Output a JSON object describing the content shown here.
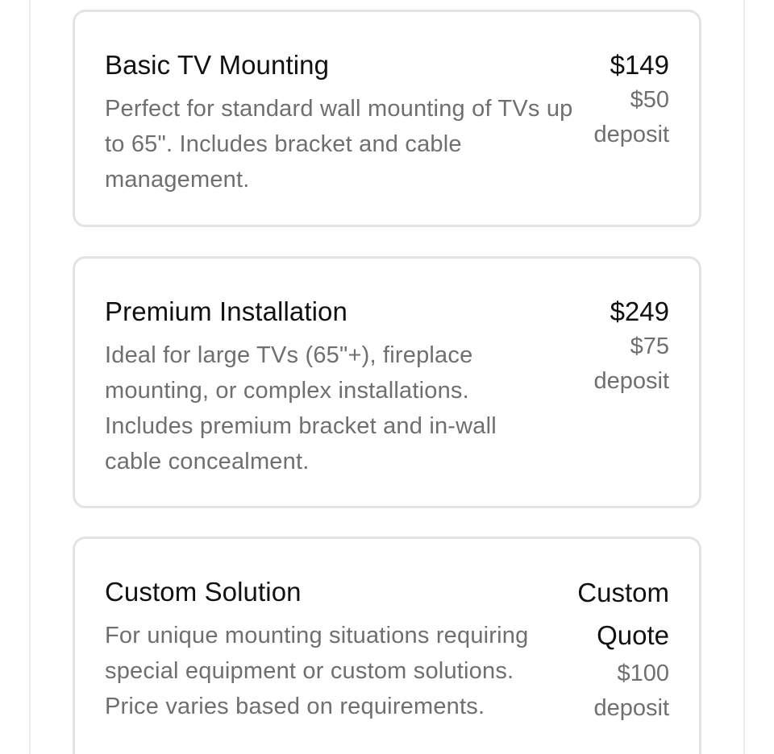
{
  "services": [
    {
      "title": "Basic TV Mounting",
      "description": "Perfect for standard wall mounting of TVs up to 65\". Includes bracket and cable management.",
      "price": "$149",
      "deposit_amount": "$50",
      "deposit_label": "deposit"
    },
    {
      "title": "Premium Installation",
      "description": "Ideal for large TVs (65\"+), fireplace mounting, or complex installations. Includes premium bracket and in-wall cable concealment.",
      "price": "$249",
      "deposit_amount": "$75",
      "deposit_label": "deposit"
    },
    {
      "title": "Custom Solution",
      "description": "For unique mounting situations requiring special equipment or custom solutions. Price varies based on requirements.",
      "price": "Custom Quote",
      "deposit_amount": "$100",
      "deposit_label": "deposit"
    }
  ]
}
